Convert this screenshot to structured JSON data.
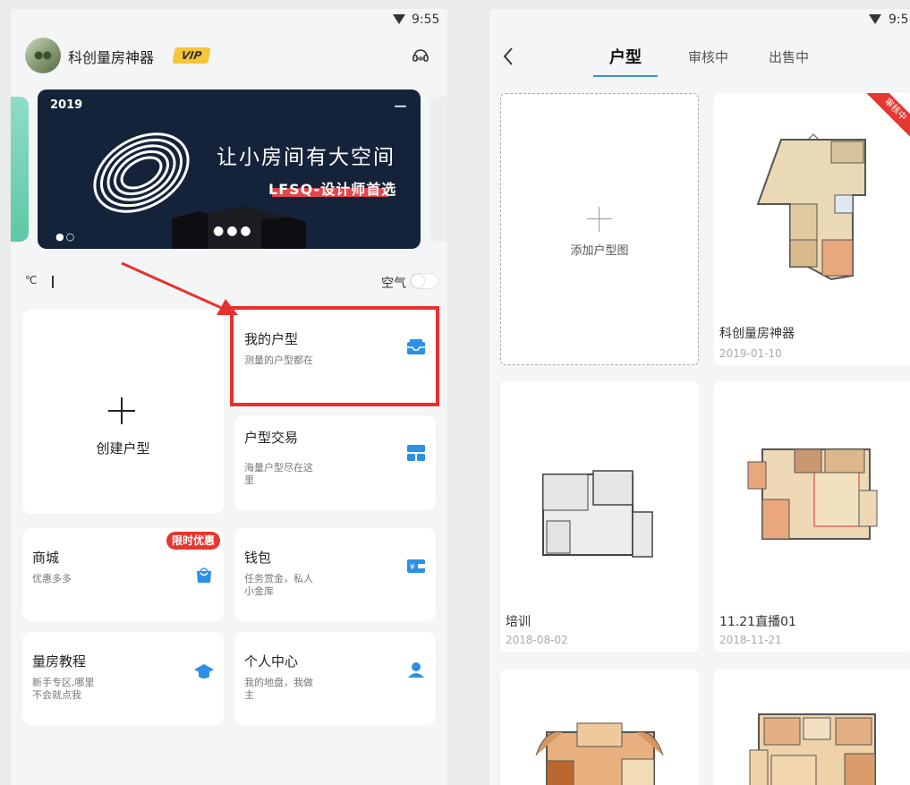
{
  "left": {
    "status": {
      "time": "9:55"
    },
    "header": {
      "app_name": "科创量房神器",
      "vip": "VIP"
    },
    "banner": {
      "year": "2019",
      "title": "让小房间有大空间",
      "subtitle": "LFSQ-设计师首选",
      "dots_left": "●○",
      "dots_center": "●●●"
    },
    "weather": {
      "temp_unit": "℃",
      "air_label": "空气"
    },
    "cards": {
      "create": {
        "label": "创建户型"
      },
      "my_plans": {
        "title": "我的户型",
        "sub": "测量的户型都在"
      },
      "trade": {
        "title": "户型交易",
        "sub": "海量户型尽在这里"
      },
      "mall": {
        "title": "商城",
        "sub": "优惠多多",
        "badge": "限时优惠"
      },
      "wallet": {
        "title": "钱包",
        "sub": "任务赏金，私人小金库"
      },
      "tutorial": {
        "title": "量房教程",
        "sub": "新手专区,哪里不会就点我"
      },
      "profile": {
        "title": "个人中心",
        "sub": "我的地盘，我做主"
      }
    },
    "icons": {
      "plans": "inbox-icon",
      "trade": "layout-icon",
      "mall": "shopping-bag-icon",
      "wallet": "wallet-icon",
      "tutorial": "graduation-cap-icon",
      "profile": "user-icon",
      "headset": "headset-icon"
    },
    "colors": {
      "accent": "#3c8ee8",
      "highlight": "#e7312f",
      "badge": "#e4372f",
      "banner_bg": "#15233a"
    }
  },
  "right": {
    "status": {
      "time": "9:5"
    },
    "tabs": [
      "户型",
      "审核中",
      "出售中"
    ],
    "add_label": "添加户型图",
    "plans": [
      {
        "name": "科创量房神器",
        "date": "2019-01-10",
        "ribbon": "审核中"
      },
      {
        "name": "培训",
        "date": "2018-08-02"
      },
      {
        "name": "11.21直播01",
        "date": "2018-11-21"
      }
    ]
  }
}
